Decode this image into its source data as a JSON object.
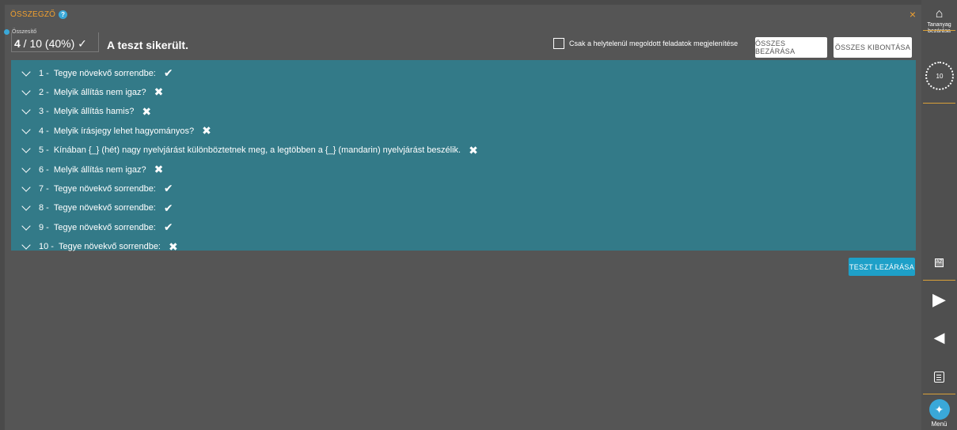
{
  "header": {
    "title": "ÖSSZEGZŐ",
    "help_icon": "?",
    "close_icon": "×"
  },
  "summary": {
    "legend": "Összesítő",
    "score_bold": "4",
    "score_rest": " / 10 (40%) ✓",
    "result": "A teszt sikerült."
  },
  "toolbar": {
    "filter_label": "Csak a helytelenül megoldott feladatok megjelenítése",
    "close_all": "ÖSSZES BEZÁRÁSA",
    "expand_all": "ÖSSZES KIBONTÁSA"
  },
  "questions": [
    {
      "num": "1 -",
      "text": "Tegye növekvő sorrendbe:",
      "mark": "✔",
      "correct": true
    },
    {
      "num": "2 -",
      "text": "Melyik állítás nem igaz?",
      "mark": "✖",
      "correct": false
    },
    {
      "num": "3 -",
      "text": "Melyik állítás hamis?",
      "mark": "✖",
      "correct": false
    },
    {
      "num": "4 -",
      "text": "Melyik írásjegy lehet hagyományos?",
      "mark": "✖",
      "correct": false
    },
    {
      "num": "5 -",
      "text": "Kínában {_} (hét) nagy nyelvjárást különböztetnek meg, a legtöbben a {_} (mandarin) nyelvjárást beszélik.",
      "mark": "✖",
      "correct": false
    },
    {
      "num": "6 -",
      "text": "Melyik állítás nem igaz?",
      "mark": "✖",
      "correct": false
    },
    {
      "num": "7 -",
      "text": "Tegye növekvő sorrendbe:",
      "mark": "✔",
      "correct": true
    },
    {
      "num": "8 -",
      "text": "Tegye növekvő sorrendbe:",
      "mark": "✔",
      "correct": true
    },
    {
      "num": "9 -",
      "text": "Tegye növekvő sorrendbe:",
      "mark": "✔",
      "correct": true
    },
    {
      "num": "10 -",
      "text": "Tegye növekvő sorrendbe:",
      "mark": "✖",
      "correct": false
    }
  ],
  "finish_button": "TESZT LEZÁRÁSA",
  "sidebar": {
    "home_label": "Tananyag bezárása",
    "timer_value": "10",
    "az_glyph": "AZ",
    "forward_glyph": "▶",
    "back_glyph": "◀",
    "menu_glyph": "✦",
    "menu_label": "Menü"
  },
  "colors": {
    "accent_orange": "#f0a030",
    "panel_teal": "#337a88",
    "button_blue": "#1ea0c8"
  }
}
